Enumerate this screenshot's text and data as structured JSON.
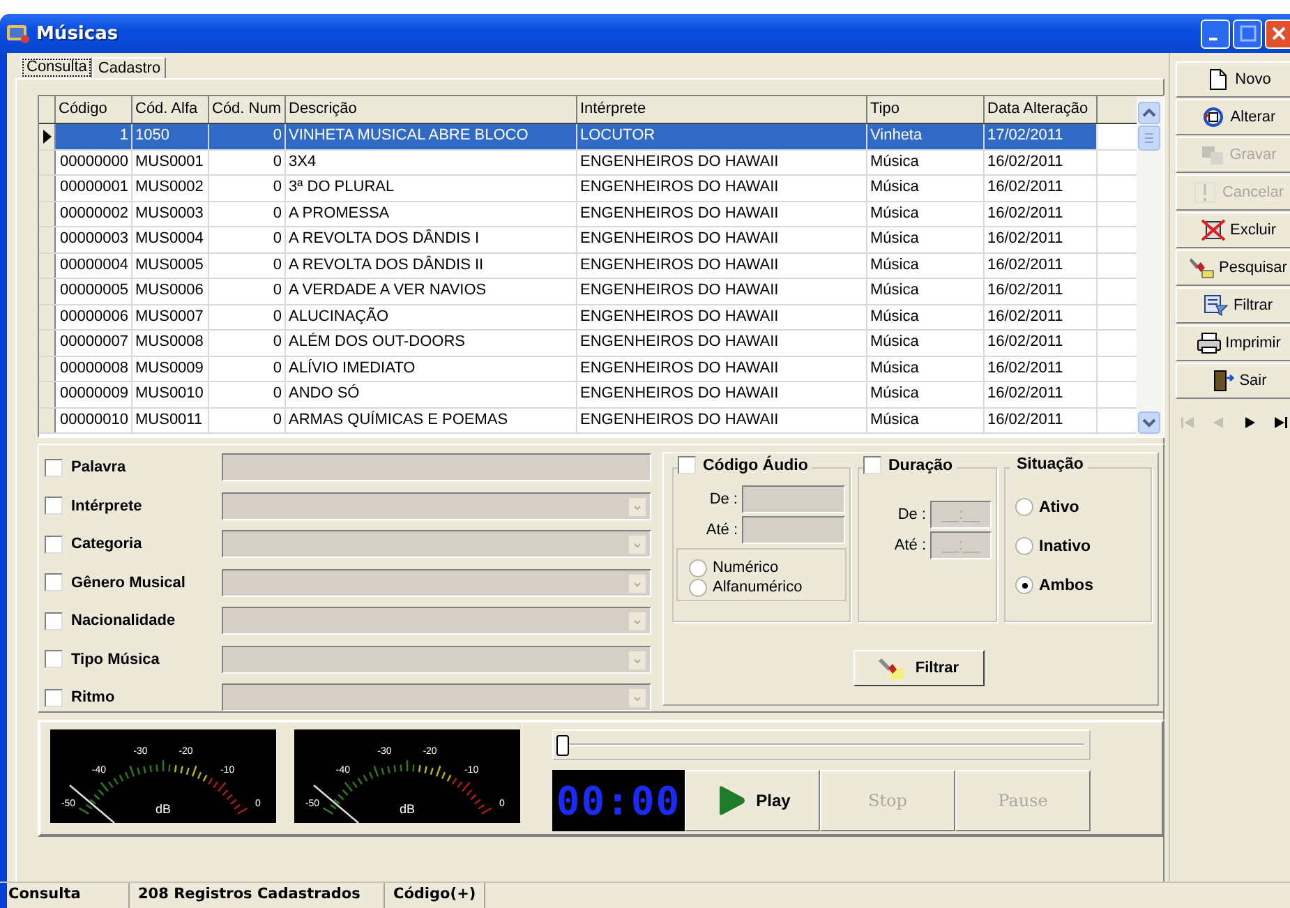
{
  "window": {
    "title": "Músicas"
  },
  "tabs": [
    {
      "label": "Consulta",
      "selected": true
    },
    {
      "label": "Cadastro",
      "selected": false
    }
  ],
  "grid": {
    "columns": [
      "Código",
      "Cód. Alfa",
      "Cód. Num",
      "Descrição",
      "Intérprete",
      "Tipo",
      "Data Alteração"
    ],
    "rows": [
      {
        "selected": true,
        "cells": [
          "1",
          "1050",
          "0",
          "VINHETA MUSICAL ABRE BLOCO",
          "LOCUTOR",
          "Vinheta",
          "17/02/2011"
        ]
      },
      {
        "selected": false,
        "cells": [
          "00000000",
          "MUS0001",
          "0",
          "3X4",
          "ENGENHEIROS DO HAWAII",
          "Música",
          "16/02/2011"
        ]
      },
      {
        "selected": false,
        "cells": [
          "00000001",
          "MUS0002",
          "0",
          "3ª DO PLURAL",
          "ENGENHEIROS DO HAWAII",
          "Música",
          "16/02/2011"
        ]
      },
      {
        "selected": false,
        "cells": [
          "00000002",
          "MUS0003",
          "0",
          "A PROMESSA",
          "ENGENHEIROS DO HAWAII",
          "Música",
          "16/02/2011"
        ]
      },
      {
        "selected": false,
        "cells": [
          "00000003",
          "MUS0004",
          "0",
          "A REVOLTA DOS DÂNDIS I",
          "ENGENHEIROS DO HAWAII",
          "Música",
          "16/02/2011"
        ]
      },
      {
        "selected": false,
        "cells": [
          "00000004",
          "MUS0005",
          "0",
          "A REVOLTA DOS DÂNDIS II",
          "ENGENHEIROS DO HAWAII",
          "Música",
          "16/02/2011"
        ]
      },
      {
        "selected": false,
        "cells": [
          "00000005",
          "MUS0006",
          "0",
          "A VERDADE A VER NAVIOS",
          "ENGENHEIROS DO HAWAII",
          "Música",
          "16/02/2011"
        ]
      },
      {
        "selected": false,
        "cells": [
          "00000006",
          "MUS0007",
          "0",
          "ALUCINAÇÃO",
          "ENGENHEIROS DO HAWAII",
          "Música",
          "16/02/2011"
        ]
      },
      {
        "selected": false,
        "cells": [
          "00000007",
          "MUS0008",
          "0",
          "ALÉM DOS OUT-DOORS",
          "ENGENHEIROS DO HAWAII",
          "Música",
          "16/02/2011"
        ]
      },
      {
        "selected": false,
        "cells": [
          "00000008",
          "MUS0009",
          "0",
          "ALÍVIO IMEDIATO",
          "ENGENHEIROS DO HAWAII",
          "Música",
          "16/02/2011"
        ]
      },
      {
        "selected": false,
        "cells": [
          "00000009",
          "MUS0010",
          "0",
          "ANDO SÓ",
          "ENGENHEIROS DO HAWAII",
          "Música",
          "16/02/2011"
        ]
      },
      {
        "selected": false,
        "cells": [
          "00000010",
          "MUS0011",
          "0",
          "ARMAS QUÍMICAS E POEMAS",
          "ENGENHEIROS DO HAWAII",
          "Música",
          "16/02/2011"
        ]
      }
    ]
  },
  "toolbar": [
    {
      "label": "Novo",
      "disabled": false
    },
    {
      "label": "Alterar",
      "disabled": false
    },
    {
      "label": "Gravar",
      "disabled": true
    },
    {
      "label": "Cancelar",
      "disabled": true
    },
    {
      "label": "Excluir",
      "disabled": false
    },
    {
      "label": "Pesquisar",
      "disabled": false
    },
    {
      "label": "Filtrar",
      "disabled": false
    },
    {
      "label": "Imprimir",
      "disabled": false
    },
    {
      "label": "Sair",
      "disabled": false
    }
  ],
  "navigator": [
    {
      "kind": "first",
      "disabled": true
    },
    {
      "kind": "prior",
      "disabled": true
    },
    {
      "kind": "next",
      "disabled": false
    },
    {
      "kind": "last",
      "disabled": false
    }
  ],
  "filters": [
    {
      "label": "Palavra",
      "checked": false,
      "kind": "text"
    },
    {
      "label": "Intérprete",
      "checked": false,
      "kind": "combo"
    },
    {
      "label": "Categoria",
      "checked": false,
      "kind": "combo"
    },
    {
      "label": "Gênero Musical",
      "checked": false,
      "kind": "combo"
    },
    {
      "label": "Nacionalidade",
      "checked": false,
      "kind": "combo"
    },
    {
      "label": "Tipo Música",
      "checked": false,
      "kind": "combo"
    },
    {
      "label": "Ritmo",
      "checked": false,
      "kind": "combo"
    }
  ],
  "codigo_audio": {
    "label": "Código Áudio",
    "checked": false,
    "from_label": "De :",
    "to_label": "Até :",
    "options": [
      {
        "label": "Numérico",
        "selected": false
      },
      {
        "label": "Alfanumérico",
        "selected": false
      }
    ]
  },
  "duracao": {
    "label": "Duração",
    "checked": false,
    "from_label": "De :",
    "to_label": "Até :",
    "from_value": "__:__",
    "to_value": "__:__"
  },
  "situacao": {
    "title": "Situação",
    "options": [
      {
        "label": "Ativo",
        "selected": false
      },
      {
        "label": "Inativo",
        "selected": false
      },
      {
        "label": "Ambos",
        "selected": true
      }
    ]
  },
  "filter_button": {
    "label": "Filtrar"
  },
  "player": {
    "meters": [
      {
        "scale": [
          "-50",
          "-40",
          "-30",
          "-20",
          "-10",
          "0"
        ],
        "unit": "dB"
      },
      {
        "scale": [
          "-50",
          "-40",
          "-30",
          "-20",
          "-10",
          "0"
        ],
        "unit": "dB"
      }
    ],
    "position": {
      "level": 0
    },
    "clock": "00:00",
    "buttons": [
      {
        "kind": "play",
        "label": "Play",
        "disabled": false
      },
      {
        "kind": "stop",
        "label": "Stop",
        "disabled": true
      },
      {
        "kind": "pause",
        "label": "Pause",
        "disabled": true
      }
    ]
  },
  "status_bar": [
    "Consulta",
    "208 Registros Cadastrados",
    "Código(+)"
  ]
}
